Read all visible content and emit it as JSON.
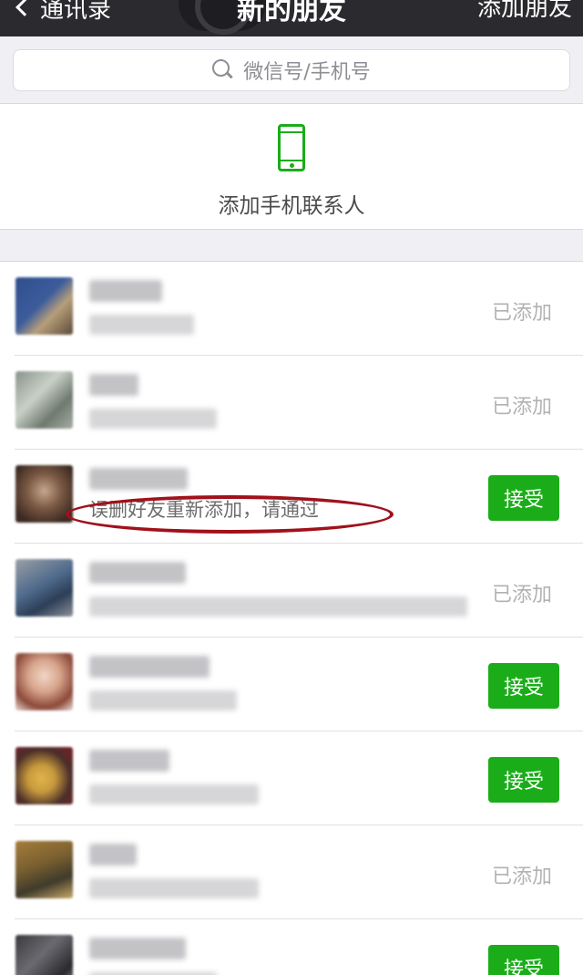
{
  "nav": {
    "back_label": "通讯录",
    "title": "新的朋友",
    "right_action": "添加朋友"
  },
  "search": {
    "placeholder": "微信号/手机号",
    "icon": "search-icon"
  },
  "add_phone": {
    "label": "添加手机联系人",
    "icon": "phone-icon"
  },
  "colors": {
    "accent_green": "#1aad19",
    "nav_bg": "#2b2b2f",
    "annotation_red": "#a0111b",
    "muted_text": "#b2b2b2"
  },
  "requests": [
    {
      "status": "added",
      "status_label": "已添加",
      "message": ""
    },
    {
      "status": "added",
      "status_label": "已添加",
      "message": ""
    },
    {
      "status": "pending",
      "status_label": "接受",
      "message": "误删好友重新添加，请通过",
      "highlighted": true
    },
    {
      "status": "added",
      "status_label": "已添加",
      "message": ""
    },
    {
      "status": "pending",
      "status_label": "接受",
      "message": ""
    },
    {
      "status": "pending",
      "status_label": "接受",
      "message": ""
    },
    {
      "status": "added",
      "status_label": "已添加",
      "message": ""
    },
    {
      "status": "pending",
      "status_label": "接受",
      "message": ""
    }
  ]
}
